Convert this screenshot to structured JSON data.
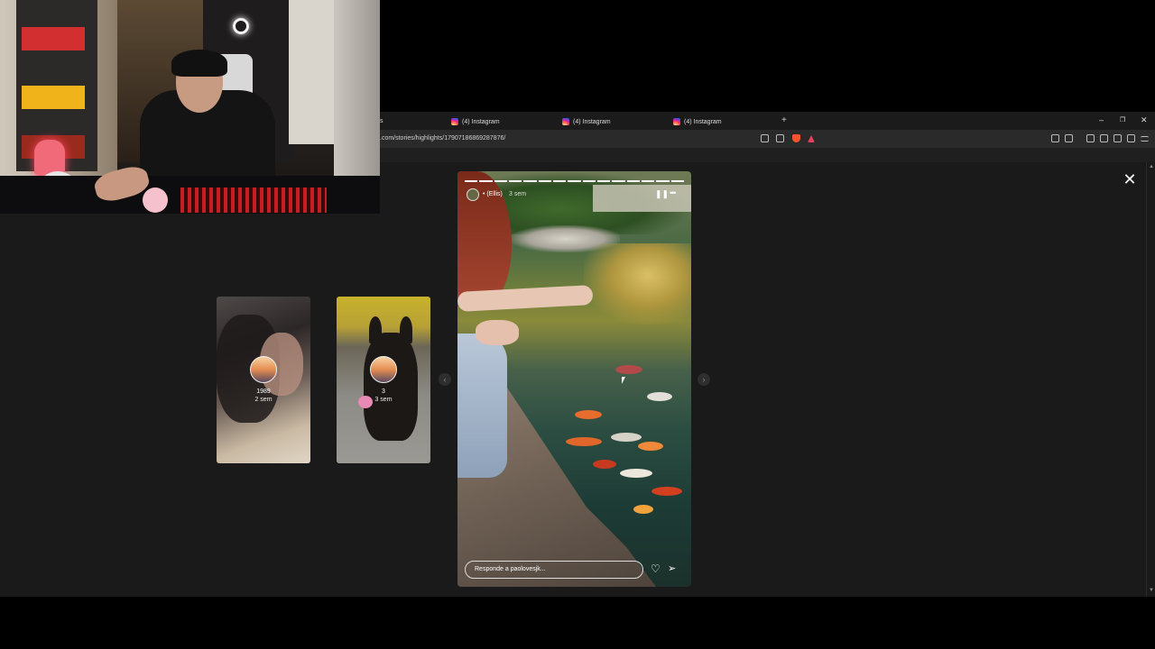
{
  "browser": {
    "tabs": [
      {
        "label": "(4) Instagram"
      },
      {
        "label": "(4) Instagram"
      },
      {
        "label": "(4) Instagram"
      }
    ],
    "partial_tab_text": "s",
    "new_tab": "+",
    "window_controls": {
      "minimize": "–",
      "restore": "❐",
      "close": "✕"
    },
    "url": ".com/stories/highlights/17907186869287876/",
    "scroll_up": "▲",
    "scroll_down": "▼"
  },
  "viewer": {
    "close": "✕",
    "prev_arrow": "‹",
    "next_arrow": "›",
    "previous_stories": [
      {
        "name": "1989",
        "time": "2 sem"
      },
      {
        "name": "3",
        "time": "3 sem"
      }
    ],
    "current_story": {
      "username": "• (Ellis)",
      "ago": "3 sem",
      "pause": "❚❚",
      "more": "•••",
      "reply_placeholder": "Responde a paolovesjk...",
      "heart": "♡",
      "send": "➢",
      "progress_segments": 15,
      "progress_done": 15
    }
  },
  "colors": {
    "instagram_gradient": [
      "#fdf497",
      "#fd5949",
      "#d6249f",
      "#285AEB"
    ],
    "page_bg": "#1a1a1a"
  }
}
